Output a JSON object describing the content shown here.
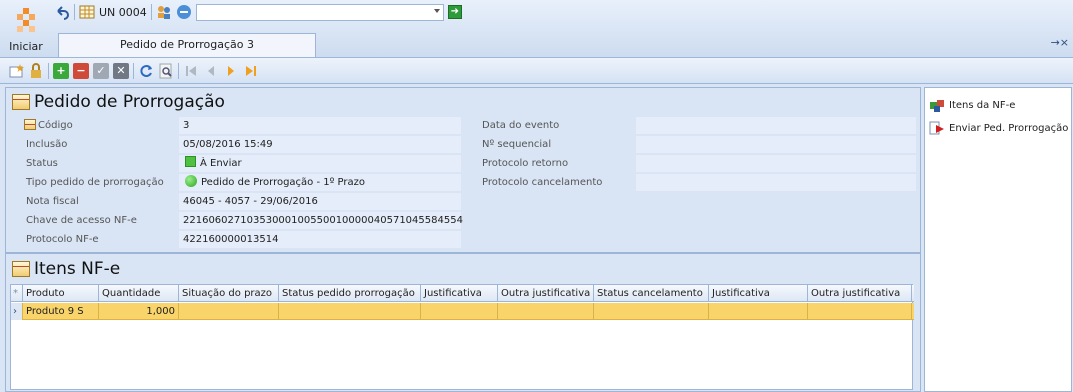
{
  "start": {
    "label": "Iniciar"
  },
  "quick": {
    "unit_label": "UN 0004",
    "combo_value": ""
  },
  "tab": {
    "title": "Pedido de Prorrogação 3",
    "ctrl": "→×"
  },
  "header": {
    "title": "Pedido de Prorrogação"
  },
  "fields_left": [
    {
      "label": "Código",
      "value": "3"
    },
    {
      "label": "Inclusão",
      "value": "05/08/2016 15:49"
    },
    {
      "label": "Status",
      "value": "À Enviar"
    },
    {
      "label": "Tipo pedido de prorrogação",
      "value": "Pedido de Prorrogação - 1º Prazo"
    },
    {
      "label": "Nota fiscal",
      "value": "46045 - 4057 - 29/06/2016"
    },
    {
      "label": "Chave de acesso NF-e",
      "value": "22160602710353000100550010000040571045584554"
    },
    {
      "label": "Protocolo NF-e",
      "value": "422160000013514"
    }
  ],
  "fields_right": [
    {
      "label": "Data do evento",
      "value": ""
    },
    {
      "label": "Nº sequencial",
      "value": ""
    },
    {
      "label": "Protocolo retorno",
      "value": ""
    },
    {
      "label": "Protocolo cancelamento",
      "value": ""
    }
  ],
  "items": {
    "title": "Itens NF-e",
    "columns": [
      "Produto",
      "Quantidade",
      "Situação do prazo",
      "Status pedido prorrogação",
      "Justificativa",
      "Outra justificativa",
      "Status cancelamento",
      "Justificativa",
      "Outra justificativa"
    ],
    "rows": [
      [
        "Produto 9 S",
        "1,000",
        "",
        "",
        "",
        "",
        "",
        "",
        ""
      ]
    ]
  },
  "side": {
    "items": [
      {
        "label": "Itens da NF-e",
        "icon": "items-icon"
      },
      {
        "label": "Enviar Ped. Prorrogação",
        "icon": "send-icon"
      }
    ]
  },
  "colors": {
    "accent_orange": "#f28c28",
    "row_highlight": "#f9d46b",
    "panel_bg": "#d9e5f5"
  }
}
